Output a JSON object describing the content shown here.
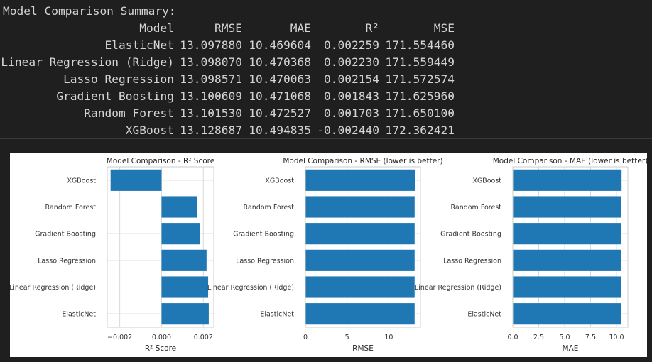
{
  "console": {
    "title": "Model Comparison Summary:",
    "headers": [
      "Model",
      "RMSE",
      "MAE",
      "R²",
      "MSE"
    ],
    "rows": [
      {
        "model": "ElasticNet",
        "rmse": "13.097880",
        "mae": "10.469604",
        "r2": "0.002259",
        "mse": "171.554460"
      },
      {
        "model": "Linear Regression (Ridge)",
        "rmse": "13.098070",
        "mae": "10.470368",
        "r2": "0.002230",
        "mse": "171.559449"
      },
      {
        "model": "Lasso Regression",
        "rmse": "13.098571",
        "mae": "10.470063",
        "r2": "0.002154",
        "mse": "171.572574"
      },
      {
        "model": "Gradient Boosting",
        "rmse": "13.100609",
        "mae": "10.471068",
        "r2": "0.001843",
        "mse": "171.625960"
      },
      {
        "model": "Random Forest",
        "rmse": "13.101530",
        "mae": "10.472527",
        "r2": "0.001703",
        "mse": "171.650100"
      },
      {
        "model": "XGBoost",
        "rmse": "13.128687",
        "mae": "10.494835",
        "r2": "-0.002440",
        "mse": "172.362421"
      }
    ]
  },
  "colors": {
    "bar": "#1f77b4",
    "grid": "#d9d9d9",
    "console_bg": "#1f1f1f",
    "console_text": "#d4d4d4"
  },
  "chart_data": [
    {
      "type": "bar",
      "orientation": "horizontal",
      "title": "Model Comparison - R² Score",
      "xlabel": "R² Score",
      "categories": [
        "ElasticNet",
        "Linear Regression (Ridge)",
        "Lasso Regression",
        "Gradient Boosting",
        "Random Forest",
        "XGBoost"
      ],
      "values": [
        0.002259,
        0.00223,
        0.002154,
        0.001843,
        0.001703,
        -0.00244
      ],
      "xlim": [
        -0.0026,
        0.0025
      ],
      "xticks": [
        -0.002,
        0.0,
        0.002
      ],
      "xtick_labels": [
        "−0.002",
        "0.000",
        "0.002"
      ],
      "grid": true
    },
    {
      "type": "bar",
      "orientation": "horizontal",
      "title": "Model Comparison - RMSE (lower is better)",
      "xlabel": "RMSE",
      "categories": [
        "ElasticNet",
        "Linear Regression (Ridge)",
        "Lasso Regression",
        "Gradient Boosting",
        "Random Forest",
        "XGBoost"
      ],
      "values": [
        13.09788,
        13.09807,
        13.098571,
        13.100609,
        13.10153,
        13.128687
      ],
      "xlim": [
        0,
        13.8
      ],
      "xticks": [
        0,
        5,
        10
      ],
      "xtick_labels": [
        "0",
        "5",
        "10"
      ],
      "grid": true
    },
    {
      "type": "bar",
      "orientation": "horizontal",
      "title": "Model Comparison - MAE (lower is better)",
      "xlabel": "MAE",
      "categories": [
        "ElasticNet",
        "Linear Regression (Ridge)",
        "Lasso Regression",
        "Gradient Boosting",
        "Random Forest",
        "XGBoost"
      ],
      "values": [
        10.469604,
        10.470368,
        10.470063,
        10.471068,
        10.472527,
        10.494835
      ],
      "xlim": [
        0,
        11.1
      ],
      "xticks": [
        0,
        2.5,
        5,
        7.5,
        10
      ],
      "xtick_labels": [
        "0.0",
        "2.5",
        "5.0",
        "7.5",
        "10.0"
      ],
      "grid": true
    }
  ]
}
